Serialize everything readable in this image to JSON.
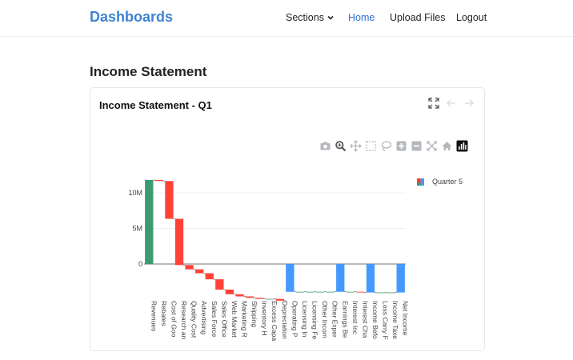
{
  "nav": {
    "brand": "Dashboards",
    "sections": "Sections",
    "home": "Home",
    "upload": "Upload Files",
    "logout": "Logout"
  },
  "page": {
    "title": "Income Statement"
  },
  "card": {
    "title": "Income Statement - Q1"
  },
  "icons": {
    "expand": "expand-icon",
    "back": "arrow-left-icon",
    "forward": "arrow-right-icon",
    "modebar": [
      "camera-icon",
      "zoom-icon",
      "pan-icon",
      "box-select-icon",
      "lasso-icon",
      "zoom-in-icon",
      "zoom-out-icon",
      "autoscale-icon",
      "home-icon",
      "plotly-logo-icon"
    ]
  },
  "colors": {
    "brand": "#3d84d6",
    "active_nav": "#2d6fd0",
    "increasing": "#3d9970",
    "decreasing": "#ff4136",
    "total": "#4499ff"
  },
  "chart_data": {
    "type": "bar",
    "subtype": "waterfall",
    "categories": [
      "Revenues",
      "Rebates",
      "Cost of Goo",
      "Research an",
      "Quality Cost",
      "Advertising",
      "Sales Force",
      "Sales Office",
      "Web Market",
      "Marketing R",
      "Shipping",
      "Inventory H",
      "Excess Capa",
      "Depreciation",
      "Operating P",
      "Licensing In",
      "Licensing Fe",
      "Other Incom",
      "Other Exper",
      "Earnings Be",
      "Interest Inc",
      "Interest Cha",
      "Income Befo",
      "Loss Carry F",
      "Income Taxe",
      "Net Income"
    ],
    "series": [
      {
        "name": "Quarter 5",
        "measures": [
          "relative",
          "relative",
          "relative",
          "relative",
          "relative",
          "relative",
          "relative",
          "relative",
          "relative",
          "relative",
          "relative",
          "relative",
          "relative",
          "relative",
          "total",
          "relative",
          "relative",
          "relative",
          "relative",
          "total",
          "relative",
          "relative",
          "total",
          "relative",
          "relative",
          "total"
        ],
        "values": [
          11800000,
          -150000,
          -5300000,
          -6500000,
          -600000,
          -550000,
          -850000,
          -1450000,
          -650000,
          -300000,
          -200000,
          -150000,
          0,
          -250000,
          -3900000,
          0,
          0,
          0,
          0,
          -3900000,
          0,
          -100000,
          -4000000,
          0,
          0,
          -4000000
        ]
      }
    ],
    "yticks": [
      "0",
      "5M",
      "10M"
    ],
    "ylim": [
      -4000000,
      11800000
    ],
    "legend": "top-right",
    "grid": true
  }
}
